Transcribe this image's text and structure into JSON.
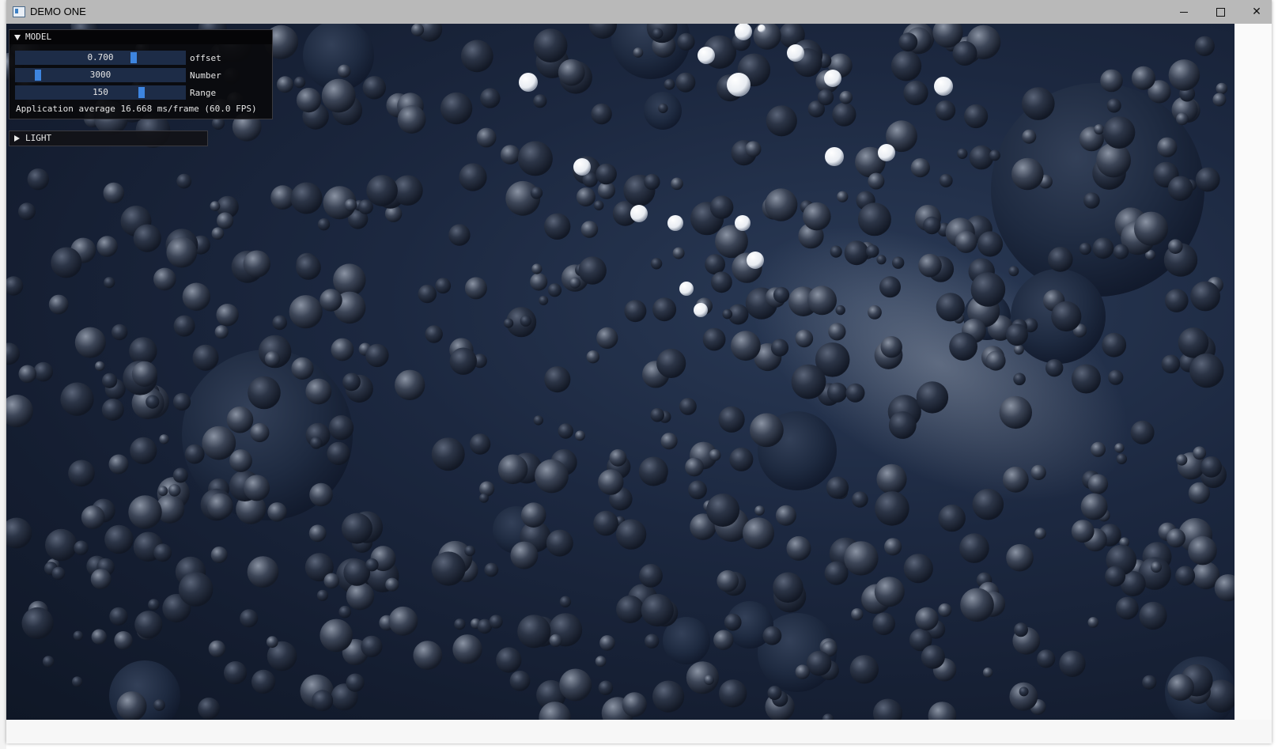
{
  "window": {
    "title": "DEMO ONE",
    "controls": {
      "minimize": "minimize-icon",
      "maximize": "maximize-icon",
      "close": "close-icon"
    }
  },
  "model_panel": {
    "header": "MODEL",
    "sliders": [
      {
        "value": "0.700",
        "label": "offset",
        "fraction": 0.7
      },
      {
        "value": "3000",
        "label": "Number",
        "fraction": 0.12
      },
      {
        "value": "150",
        "label": "Range",
        "fraction": 0.75
      }
    ],
    "fps_text": "Application average 16.668 ms/frame (60.0 FPS)"
  },
  "light_panel": {
    "header": "LIGHT"
  },
  "colors": {
    "background": "#1a2438",
    "slider_bg": "#1d2c47",
    "slider_grab": "#3d85e0",
    "panel_bg": "#0a0a0c"
  }
}
